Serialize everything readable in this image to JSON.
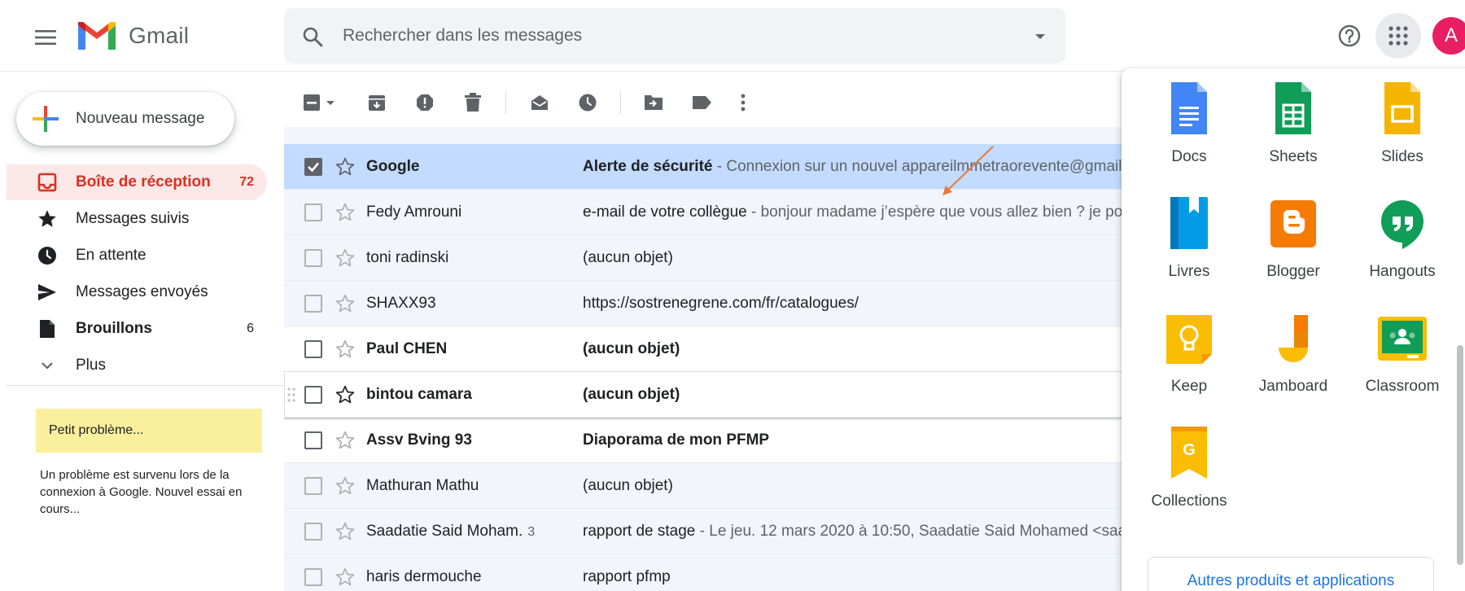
{
  "header": {
    "app_name": "Gmail",
    "search_placeholder": "Rechercher dans les messages",
    "avatar_letter": "A"
  },
  "colors": {
    "accent": "#d93025",
    "selected_row": "#c2dbff",
    "link": "#1a73e8",
    "avatar": "#e91e63"
  },
  "sidebar": {
    "compose_label": "Nouveau message",
    "items": [
      {
        "label": "Boîte de réception",
        "count": "72",
        "icon": "inbox-icon"
      },
      {
        "label": "Messages suivis",
        "count": "",
        "icon": "star-icon"
      },
      {
        "label": "En attente",
        "count": "",
        "icon": "clock-icon"
      },
      {
        "label": "Messages envoyés",
        "count": "",
        "icon": "send-icon"
      },
      {
        "label": "Brouillons",
        "count": "6",
        "icon": "draft-icon"
      },
      {
        "label": "Plus",
        "count": "",
        "icon": "chevron-down-icon"
      }
    ],
    "notice_title": "Petit problème...",
    "notice_text": "Un problème est survenu lors de la connexion à Google. Nouvel essai en cours..."
  },
  "mails": [
    {
      "sender": "Google",
      "count": "",
      "subject": "Alerte de sécurité",
      "snippet": " - Connexion sur un nouvel appareilmmetraorevente@gmail.c"
    },
    {
      "sender": "Fedy Amrouni",
      "count": "",
      "subject": "e-mail de votre collègue",
      "snippet": " - bonjour madame j’espère que vous allez bien ? je pou"
    },
    {
      "sender": "toni radinski",
      "count": "",
      "subject": "(aucun objet)",
      "snippet": ""
    },
    {
      "sender": "SHAXX93",
      "count": "",
      "subject": "https://sostrenegrene.com/fr/catalogues/",
      "snippet": ""
    },
    {
      "sender": "Paul CHEN",
      "count": "",
      "subject": "(aucun objet)",
      "snippet": ""
    },
    {
      "sender": "bintou camara",
      "count": "",
      "subject": "(aucun objet)",
      "snippet": ""
    },
    {
      "sender": "Assv Bving 93",
      "count": "",
      "subject": "Diaporama de mon PFMP",
      "snippet": ""
    },
    {
      "sender": "Mathuran Mathu",
      "count": "",
      "subject": "(aucun objet)",
      "snippet": ""
    },
    {
      "sender": "Saadatie Said Moham.",
      "count": "3",
      "subject": "rapport de stage",
      "snippet": " - Le jeu. 12 mars 2020 à 10:50, Saadatie Said Mohamed <saa"
    },
    {
      "sender": "haris dermouche",
      "count": "",
      "subject": "rapport pfmp",
      "snippet": ""
    }
  ],
  "apps_panel": {
    "apps": [
      {
        "label": "Docs",
        "icon": "docs-icon"
      },
      {
        "label": "Sheets",
        "icon": "sheets-icon"
      },
      {
        "label": "Slides",
        "icon": "slides-icon"
      },
      {
        "label": "Livres",
        "icon": "books-icon"
      },
      {
        "label": "Blogger",
        "icon": "blogger-icon"
      },
      {
        "label": "Hangouts",
        "icon": "hangouts-icon"
      },
      {
        "label": "Keep",
        "icon": "keep-icon"
      },
      {
        "label": "Jamboard",
        "icon": "jamboard-icon"
      },
      {
        "label": "Classroom",
        "icon": "classroom-icon"
      },
      {
        "label": "Collections",
        "icon": "collections-icon"
      }
    ],
    "more_label": "Autres produits et applications"
  }
}
